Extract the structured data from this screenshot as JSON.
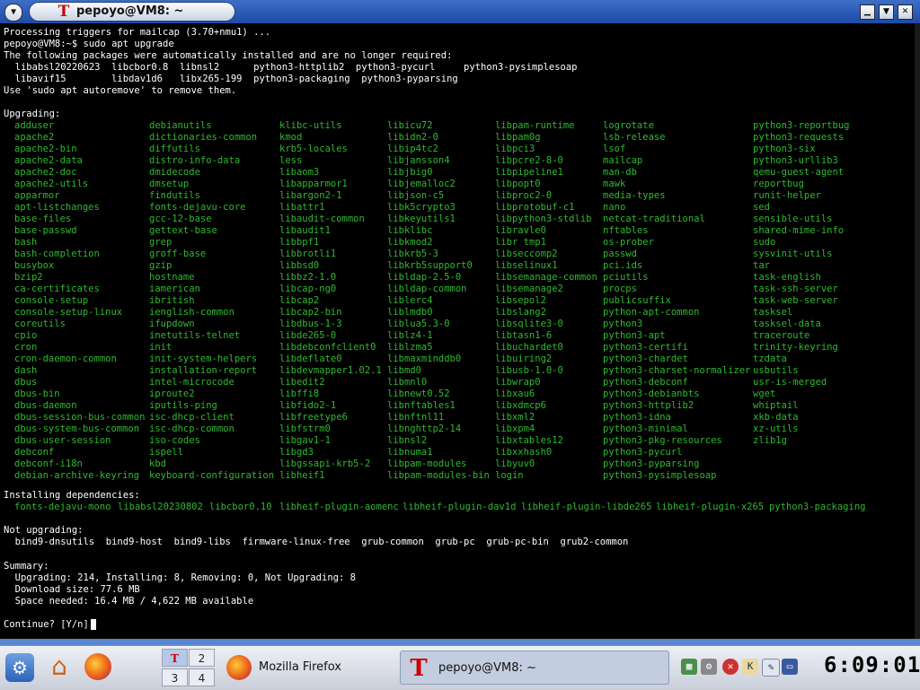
{
  "window": {
    "title": "pepoyo@VM8: ~",
    "app_icon": "T"
  },
  "terminal": {
    "lines": [
      "Processing triggers for mailcap (3.70+nmu1) ...",
      "pepoyo@VM8:~$ sudo apt upgrade",
      "The following packages were automatically installed and are no longer required:",
      "  libabsl20220623  libcbor0.8  libnsl2      python3-httplib2  python3-pycurl     python3-pysimplesoap",
      "  libavif15        libdav1d6   libx265-199  python3-packaging  python3-pyparsing",
      "Use 'sudo apt autoremove' to remove them.",
      "",
      "Upgrading:"
    ],
    "upgrading": [
      [
        "adduser",
        "apache2",
        "apache2-bin",
        "apache2-data",
        "apache2-doc",
        "apache2-utils",
        "apparmor",
        "apt-listchanges",
        "base-files",
        "base-passwd",
        "bash",
        "bash-completion",
        "busybox",
        "bzip2",
        "ca-certificates",
        "console-setup",
        "console-setup-linux",
        "coreutils",
        "cpio",
        "cron",
        "cron-daemon-common",
        "dash",
        "dbus",
        "dbus-bin",
        "dbus-daemon",
        "dbus-session-bus-common",
        "dbus-system-bus-common",
        "dbus-user-session",
        "debconf",
        "debconf-i18n",
        "debian-archive-keyring"
      ],
      [
        "debianutils",
        "dictionaries-common",
        "diffutils",
        "distro-info-data",
        "dmidecode",
        "dmsetup",
        "findutils",
        "fonts-dejavu-core",
        "gcc-12-base",
        "gettext-base",
        "grep",
        "groff-base",
        "gzip",
        "hostname",
        "iamerican",
        "ibritish",
        "ienglish-common",
        "ifupdown",
        "inetutils-telnet",
        "init",
        "init-system-helpers",
        "installation-report",
        "intel-microcode",
        "iproute2",
        "iputils-ping",
        "isc-dhcp-client",
        "isc-dhcp-common",
        "iso-codes",
        "ispell",
        "kbd",
        "keyboard-configuration"
      ],
      [
        "klibc-utils",
        "kmod",
        "krb5-locales",
        "less",
        "libaom3",
        "libapparmor1",
        "libargon2-1",
        "libattr1",
        "libaudit-common",
        "libaudit1",
        "libbpf1",
        "libbrotli1",
        "libbsd0",
        "libbz2-1.0",
        "libcap-ng0",
        "libcap2",
        "libcap2-bin",
        "libdbus-1-3",
        "libde265-0",
        "libdebconfclient0",
        "libdeflate0",
        "libdevmapper1.02.1",
        "libedit2",
        "libffi8",
        "libfido2-1",
        "libfreetype6",
        "libfstrm0",
        "libgav1-1",
        "libgd3",
        "libgssapi-krb5-2",
        "libheif1"
      ],
      [
        "libicu72",
        "libidn2-0",
        "libip4tc2",
        "libjansson4",
        "libjbig0",
        "libjemalloc2",
        "libjson-c5",
        "libk5crypto3",
        "libkeyutils1",
        "libklibc",
        "libkmod2",
        "libkrb5-3",
        "libkrb5support0",
        "libldap-2.5-0",
        "libldap-common",
        "liblerc4",
        "liblmdb0",
        "liblua5.3-0",
        "liblz4-1",
        "liblzma5",
        "libmaxminddb0",
        "libmd0",
        "libmnl0",
        "libnewt0.52",
        "libnftables1",
        "libnftnl11",
        "libnghttp2-14",
        "libnsl2",
        "libnuma1",
        "libpam-modules",
        "libpam-modules-bin"
      ],
      [
        "libpam-runtime",
        "libpam0g",
        "libpci3",
        "libpcre2-8-0",
        "libpipeline1",
        "libpopt0",
        "libproc2-0",
        "libprotobuf-c1",
        "libpython3-stdlib",
        "libravle0",
        "libr tmp1",
        "libseccomp2",
        "libselinux1",
        "libsemanage-common",
        "libsemanage2",
        "libsepol2",
        "libslang2",
        "libsqlite3-0",
        "libtasn1-6",
        "libuchardet0",
        "libuiring2",
        "libusb-1.0-0",
        "libwrap0",
        "libxau6",
        "libxdmcp6",
        "libxml2",
        "libxpm4",
        "libxtables12",
        "libxxhash0",
        "libyuv0",
        "login"
      ],
      [
        "logrotate",
        "lsb-release",
        "lsof",
        "mailcap",
        "man-db",
        "mawk",
        "media-types",
        "nano",
        "netcat-traditional",
        "nftables",
        "os-prober",
        "passwd",
        "pci.ids",
        "pciutils",
        "procps",
        "publicsuffix",
        "python-apt-common",
        "python3",
        "python3-apt",
        "python3-certifi",
        "python3-chardet",
        "python3-charset-normalizer",
        "python3-debconf",
        "python3-debianbts",
        "python3-httplib2",
        "python3-idna",
        "python3-minimal",
        "python3-pkg-resources",
        "python3-pycurl",
        "python3-pyparsing",
        "python3-pysimplesoap"
      ],
      [
        "python3-reportbug",
        "python3-requests",
        "python3-six",
        "python3-urllib3",
        "qemu-guest-agent",
        "reportbug",
        "runit-helper",
        "sed",
        "sensible-utils",
        "shared-mime-info",
        "sudo",
        "sysvinit-utils",
        "tar",
        "task-english",
        "task-ssh-server",
        "task-web-server",
        "tasksel",
        "tasksel-data",
        "traceroute",
        "trinity-keyring",
        "tzdata",
        "usbutils",
        "usr-is-merged",
        "wget",
        "whiptail",
        "xkb-data",
        "xz-utils",
        "zlib1g"
      ]
    ],
    "installing_header": "Installing dependencies:",
    "installing": [
      "fonts-dejavu-mono",
      "libabsl20230802",
      "libcbor0.10",
      "libheif-plugin-aomenc",
      "libheif-plugin-dav1d",
      "libheif-plugin-libde265",
      "libheif-plugin-x265",
      "python3-packaging"
    ],
    "not_upgrading_header": "Not upgrading:",
    "not_upgrading_line": "  bind9-dnsutils  bind9-host  bind9-libs  firmware-linux-free  grub-common  grub-pc  grub-pc-bin  grub2-common",
    "summary_lines": [
      "Summary:",
      "  Upgrading: 214, Installing: 8, Removing: 0, Not Upgrading: 8",
      "  Download size: 77.6 MB",
      "  Space needed: 16.4 MB / 4,622 MB available",
      "",
      "Continue? [Y/n] "
    ]
  },
  "taskbar": {
    "pager": [
      "2",
      "3",
      "4"
    ],
    "pager_active_icon": "T",
    "tasks": [
      {
        "label": "Mozilla Firefox"
      },
      {
        "label": "pepoyo@VM8: ~"
      }
    ],
    "clock": "6:09:01"
  },
  "colors": {
    "package_green": "#2fb82f",
    "titlebar_blue": "#2553b0"
  }
}
